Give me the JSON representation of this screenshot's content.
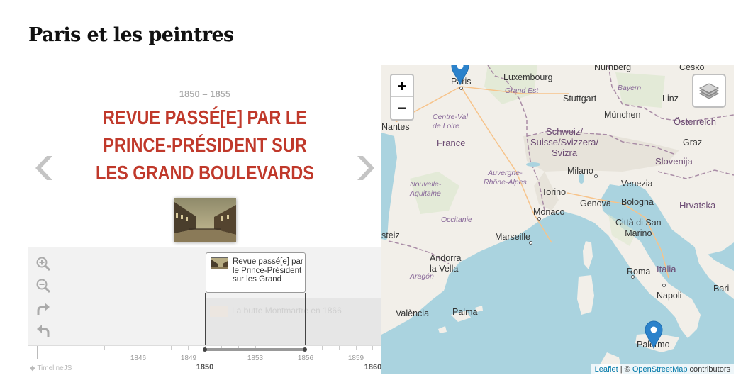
{
  "page": {
    "title": "Paris et les peintres"
  },
  "timeline": {
    "slide": {
      "date": "1850 – 1855",
      "headline": "Revue passé[e] par le Prince-Président sur les Grand Boulevards"
    },
    "markers": [
      {
        "text": "Revue passé[e] par le Prince-Président sur les Grand"
      },
      {
        "text": "La butte Montmartre en 1866"
      }
    ],
    "axis": {
      "minor_ticks": [
        "1846",
        "1849",
        "1853",
        "1856",
        "1859"
      ],
      "major_ticks": [
        "1850",
        "1860"
      ]
    },
    "branding": "TimelineJS"
  },
  "map": {
    "zoom_in": "+",
    "zoom_out": "−",
    "labels": {
      "nurnberg": "Nürnberg",
      "cesko": "Česko",
      "luxembourg": "Luxembourg",
      "grand_est": "Grand Est",
      "bayern": "Bayern",
      "paris": "Paris",
      "stuttgart": "Stuttgart",
      "linz": "Linz",
      "centre": "Centre-Val\nde Loire",
      "munchen": "München",
      "osterreich": "Österreich",
      "nantes": "Nantes",
      "schweiz": "Schweiz/\nSuisse/Svizzera/\nSvizra",
      "graz": "Graz",
      "france": "France",
      "slovenija": "Slovenija",
      "auvergne": "Auvergne-\nRhône-Alpes",
      "milano": "Milano",
      "nouvelle": "Nouvelle-\nAquitaine",
      "venezia": "Venezia",
      "torino": "Torino",
      "genova": "Genova",
      "bologna": "Bologna",
      "hrvatska": "Hrvatska",
      "monaco": "Monaco",
      "occitanie": "Occitanie",
      "marseille": "Marseille",
      "san_marino": "Città di San\nMarino",
      "steiz": "steiz",
      "andorra": "Andorra\nla Vella",
      "roma": "Roma",
      "italia": "Italia",
      "aragon": "Aragón",
      "bari": "Bari",
      "napoli": "Napoli",
      "valencia": "València",
      "palma": "Palma",
      "palermo": "Palermo"
    },
    "attribution": {
      "leaflet": "Leaflet",
      "sep": " | © ",
      "osm": "OpenStreetMap",
      "suffix": " contributors"
    }
  }
}
